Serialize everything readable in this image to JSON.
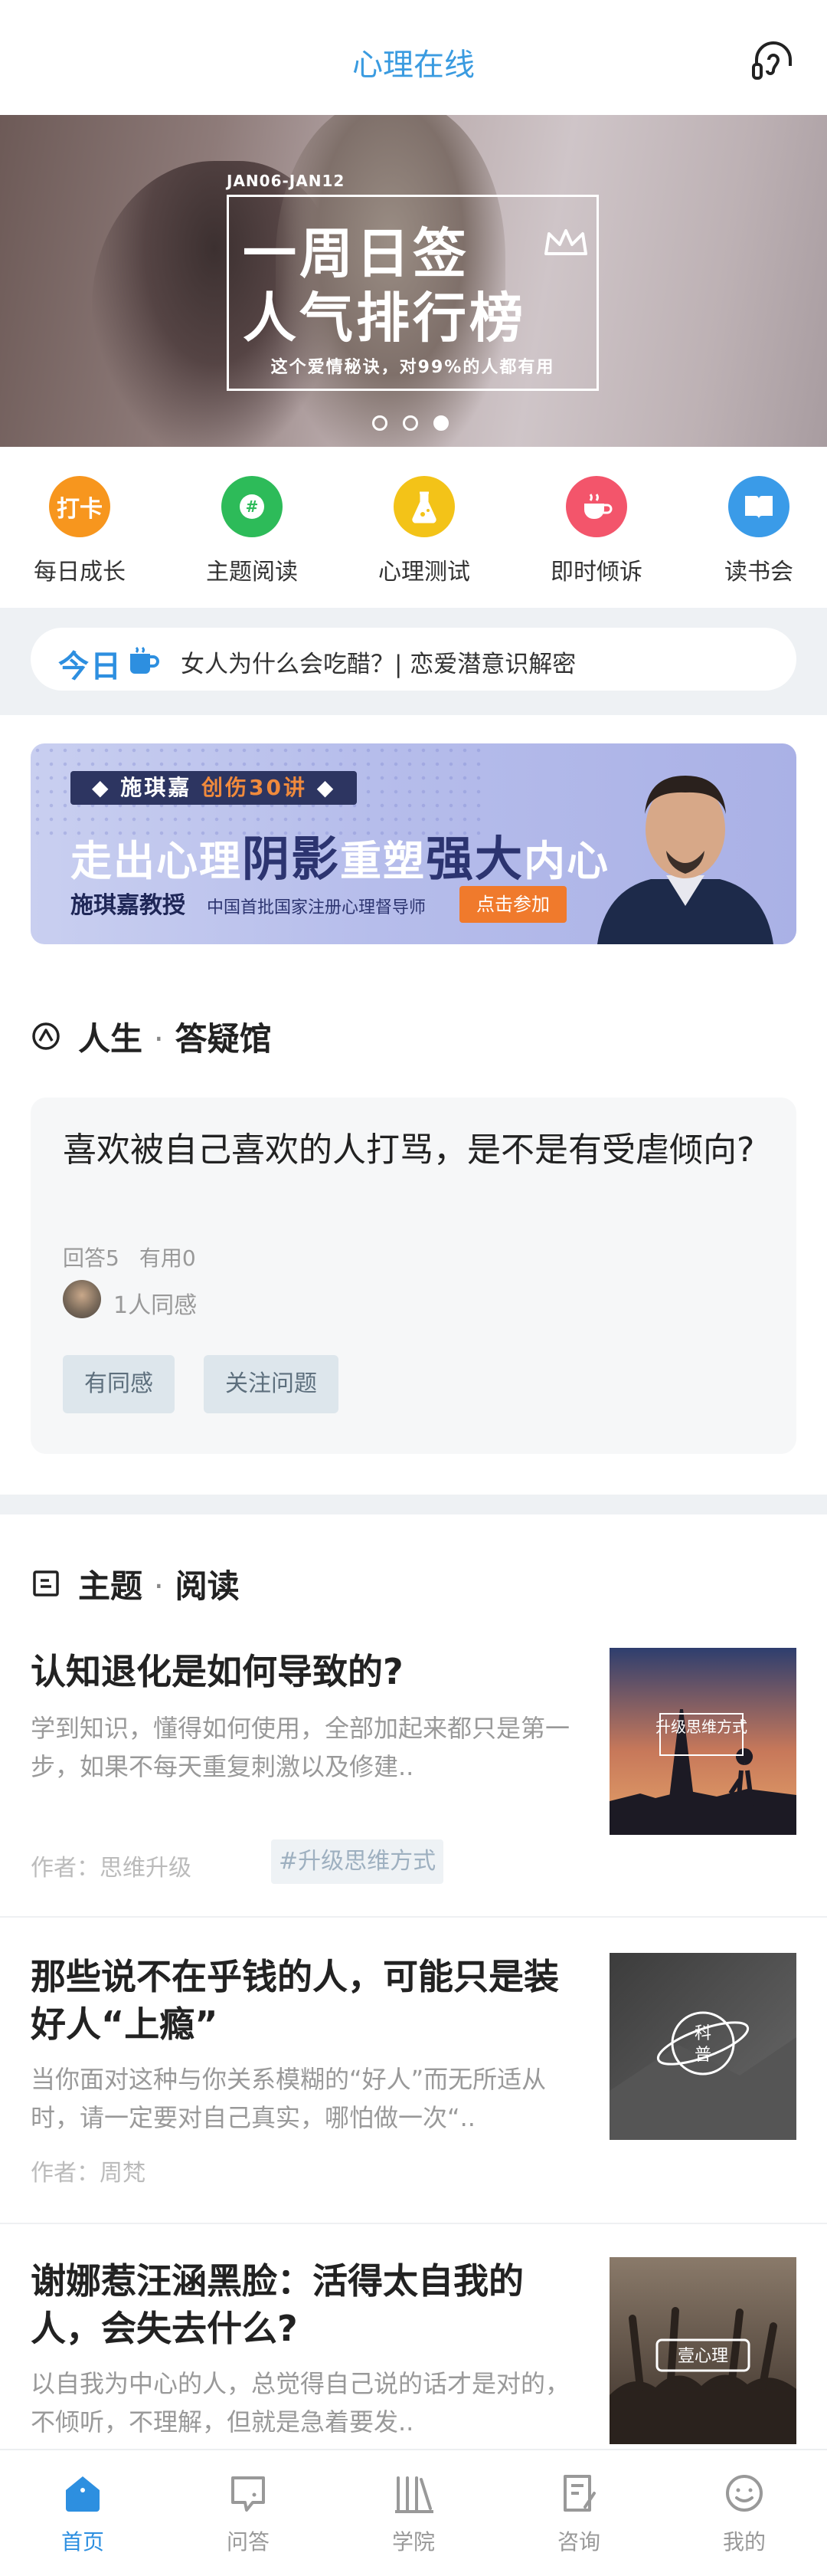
{
  "header": {
    "title": "心理在线",
    "icon": "headset-icon"
  },
  "banner": {
    "date": "JAN06-JAN12",
    "line1": "一周日签",
    "line2": "人气排行榜",
    "sub": "这个爱情秘诀，对99%的人都有用",
    "pages": 3,
    "active_page": 3
  },
  "quick_nav": [
    {
      "label": "每日成长",
      "icon_text": "打卡",
      "color": "#f7961e",
      "icon": "checkin-icon"
    },
    {
      "label": "主题阅读",
      "icon_text": "#",
      "color": "#2dbb59",
      "icon": "hashtag-icon"
    },
    {
      "label": "心理测试",
      "icon_text": "",
      "color": "#f3c318",
      "icon": "flask-icon"
    },
    {
      "label": "即时倾诉",
      "icon_text": "",
      "color": "#f3556b",
      "icon": "coffee-icon"
    },
    {
      "label": "读书会",
      "icon_text": "",
      "color": "#3a9be8",
      "icon": "book-icon"
    }
  ],
  "today": {
    "logo": "今日",
    "text": "女人为什么会吃醋？| 恋爱潜意识解密"
  },
  "ad": {
    "tag_prefix": "施琪嘉",
    "tag_highlight": "创伤30讲",
    "title_a": "走出心理",
    "title_b": "阴影",
    "title_c": "重塑",
    "title_d": "强大",
    "title_e": "内心",
    "professor": "施琪嘉教授",
    "desc": "中国首批国家注册心理督导师",
    "button": "点击参加"
  },
  "qa_section": {
    "title_a": "人生",
    "sep": "·",
    "title_b": "答疑馆",
    "question": "喜欢被自己喜欢的人打骂，是不是有受虐倾向?",
    "answers": "回答5",
    "useful": "有用0",
    "agree_count": "1人同感",
    "btn_agree": "有同感",
    "btn_follow": "关注问题"
  },
  "read_section": {
    "title_a": "主题",
    "sep": "·",
    "title_b": "阅读",
    "articles": [
      {
        "title": "认知退化是如何导致的?",
        "desc": "学到知识，懂得如何使用，全部加起来都只是第一步，如果不每天重复刺激以及修建..",
        "author": "作者：思维升级",
        "tag": "#升级思维方式",
        "thumb_text": "升级思维方式"
      },
      {
        "title": "那些说不在乎钱的人，可能只是装好人“上瘾”",
        "desc": "当你面对这种与你关系模糊的“好人”而无所适从时，请一定要对自己真实，哪怕做一次“..",
        "author": "作者：周梵",
        "thumb_text": "科普"
      },
      {
        "title": "谢娜惹汪涵黑脸：活得太自我的人，会失去什么?",
        "desc": "以自我为中心的人，总觉得自己说的话才是对的，不倾听，不理解，但就是急着要发..",
        "thumb_text": "壹心理"
      }
    ]
  },
  "tabbar": [
    {
      "label": "首页",
      "icon": "home-icon",
      "active": true
    },
    {
      "label": "问答",
      "icon": "qa-icon",
      "active": false
    },
    {
      "label": "学院",
      "icon": "library-icon",
      "active": false
    },
    {
      "label": "咨询",
      "icon": "consult-icon",
      "active": false
    },
    {
      "label": "我的",
      "icon": "profile-icon",
      "active": false
    }
  ]
}
